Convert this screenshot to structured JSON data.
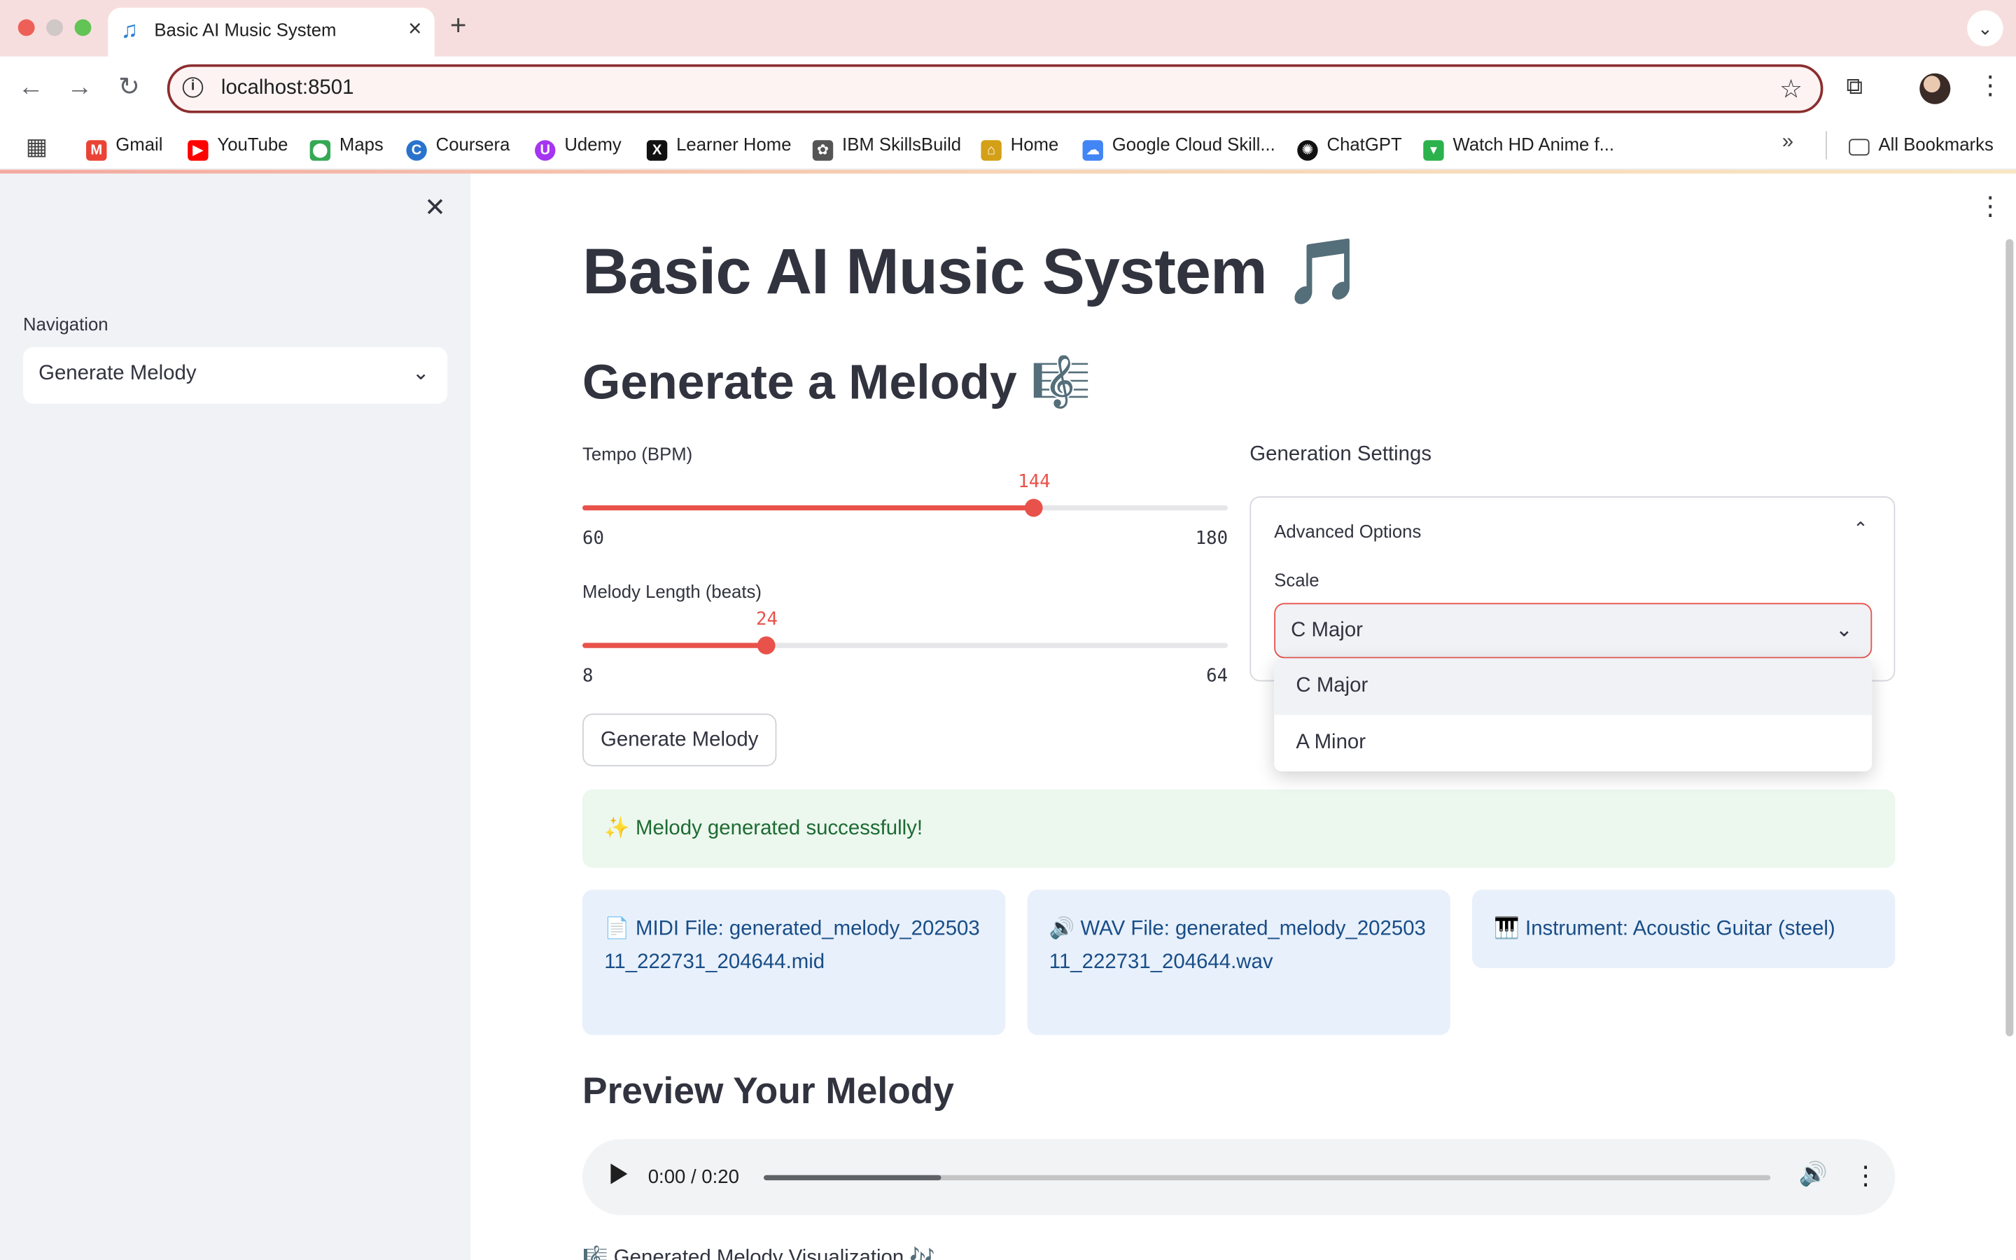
{
  "browser": {
    "tab_title": "Basic AI Music System",
    "tab_icon": "music-note-icon",
    "url": "localhost:8501",
    "bookmarks": [
      {
        "label": "Gmail",
        "color": "#ea4335"
      },
      {
        "label": "YouTube",
        "color": "#ff0000"
      },
      {
        "label": "Maps",
        "color": "#34a853"
      },
      {
        "label": "Coursera",
        "color": "#2a73cc"
      },
      {
        "label": "Udemy",
        "color": "#a435f0"
      },
      {
        "label": "Learner Home",
        "color": "#111111"
      },
      {
        "label": "IBM SkillsBuild",
        "color": "#555555"
      },
      {
        "label": "Home",
        "color": "#d4a017"
      },
      {
        "label": "Google Cloud Skill...",
        "color": "#4285f4"
      },
      {
        "label": "ChatGPT",
        "color": "#111111"
      },
      {
        "label": "Watch HD Anime f...",
        "color": "#2bb24c"
      }
    ],
    "all_bookmarks": "All Bookmarks"
  },
  "sidebar": {
    "nav_label": "Navigation",
    "nav_value": "Generate Melody"
  },
  "main": {
    "title": "Basic AI Music System 🎵",
    "subtitle": "Generate a Melody 🎼",
    "tempo": {
      "label": "Tempo (BPM)",
      "value": 144,
      "min": 60,
      "max": 180,
      "value_text": "144",
      "min_text": "60",
      "max_text": "180"
    },
    "length": {
      "label": "Melody Length (beats)",
      "value": 24,
      "min": 8,
      "max": 64,
      "value_text": "24",
      "min_text": "8",
      "max_text": "64"
    },
    "generate_button": "Generate Melody",
    "settings_heading": "Generation Settings",
    "advanced_options": "Advanced Options",
    "scale_label": "Scale",
    "scale_value": "C Major",
    "scale_options": [
      "C Major",
      "A Minor"
    ],
    "success_message": "✨ Melody generated successfully!",
    "midi_file": "📄 MIDI File: generated_melody_20250311_222731_204644.mid",
    "wav_file": "🔊 WAV File: generated_melody_20250311_222731_204644.wav",
    "instrument": "🎹 Instrument: Acoustic Guitar (steel)",
    "preview_heading": "Preview Your Melody",
    "audio_time": "0:00 / 0:20",
    "audio_buffered_fraction": 0.176,
    "bottom_text": "🎼 Generated Melody Visualization 🎶"
  },
  "colors": {
    "accent": "#e8524a",
    "sidebar_bg": "#f0f2f6",
    "success_bg": "#ecf7ee",
    "info_bg": "#e8f0fb"
  }
}
